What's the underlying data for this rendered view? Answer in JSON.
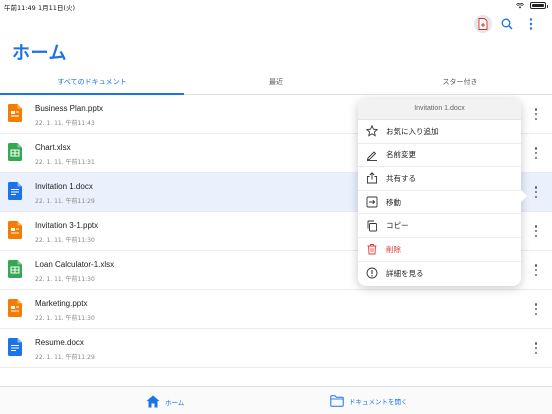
{
  "status_bar": {
    "time": "午前11:49",
    "date": "1月11日(火)"
  },
  "toolbar": {
    "icons": [
      "new-document-icon",
      "search-icon",
      "more-vertical-icon"
    ]
  },
  "header": {
    "title": "ホーム"
  },
  "tabs": [
    {
      "label": "すべてのドキュメント",
      "selected": true
    },
    {
      "label": "最近",
      "selected": false
    },
    {
      "label": "スター付き",
      "selected": false
    }
  ],
  "files": [
    {
      "name": "Business Plan.pptx",
      "meta": "22. 1. 11. 午前11:43",
      "type": "pptx"
    },
    {
      "name": "Chart.xlsx",
      "meta": "22. 1. 11. 午前11:31",
      "type": "xlsx"
    },
    {
      "name": "Invitation 1.docx",
      "meta": "22. 1. 11. 午前11:29",
      "type": "docx",
      "selected": true
    },
    {
      "name": "Invitation 3-1.pptx",
      "meta": "22. 1. 11. 午前11:30",
      "type": "pptx"
    },
    {
      "name": "Loan Calculator-1.xlsx",
      "meta": "22. 1. 11. 午前11:30",
      "type": "xlsx"
    },
    {
      "name": "Marketing.pptx",
      "meta": "22. 1. 11. 午前11:30",
      "type": "pptx"
    },
    {
      "name": "Resume.docx",
      "meta": "22. 1. 11. 午前11:29",
      "type": "docx"
    }
  ],
  "context_menu": {
    "title": "Invitation 1.docx",
    "items": [
      {
        "label": "お気に入り追加",
        "icon": "star-icon"
      },
      {
        "label": "名前変更",
        "icon": "rename-icon"
      },
      {
        "label": "共有する",
        "icon": "share-icon"
      },
      {
        "label": "移動",
        "icon": "move-icon"
      },
      {
        "label": "コピー",
        "icon": "copy-icon"
      },
      {
        "label": "削除",
        "icon": "trash-icon",
        "danger": true
      },
      {
        "label": "詳細を見る",
        "icon": "info-icon"
      }
    ]
  },
  "bottom_nav": {
    "home_label": "ホーム",
    "open_label": "ドキュメントを開く"
  },
  "colors": {
    "accent": "#1a73e8",
    "pptx": "#f57c00",
    "xlsx": "#34a853",
    "docx": "#1a73e8",
    "danger": "#e53935"
  }
}
